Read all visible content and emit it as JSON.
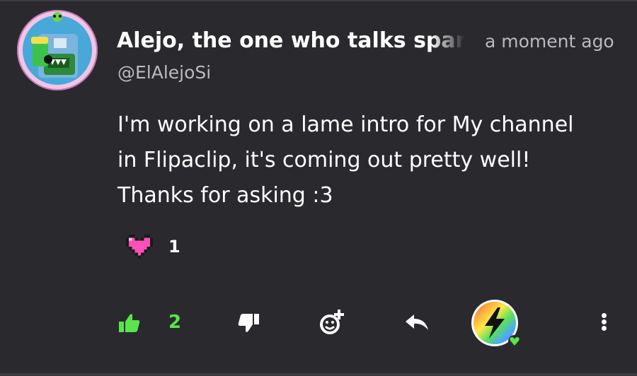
{
  "post": {
    "username": "Alejo, the one who talks spani",
    "handle": "@ElAlejoSi",
    "timestamp": "a moment ago",
    "message_lines": [
      "I'm working on a lame intro for My channel",
      "in Flipaclip, it's coming out pretty well!",
      "Thanks for asking :3"
    ]
  },
  "reactions": {
    "heart_icon": "pixel-heart-icon",
    "heart_count": "1"
  },
  "actions": {
    "like_count": "2",
    "like_icon": "thumbs-up-icon",
    "dislike_icon": "thumbs-down-icon",
    "add_reaction_icon": "add-emoji-icon",
    "reply_icon": "reply-arrow-icon",
    "more_icon": "more-vertical-icon"
  },
  "colors": {
    "background": "#2a2a2e",
    "like_green": "#58e64a",
    "heart_pink": "#ff4fb8",
    "text_primary": "#ffffff",
    "text_secondary": "#b9b9bf"
  }
}
